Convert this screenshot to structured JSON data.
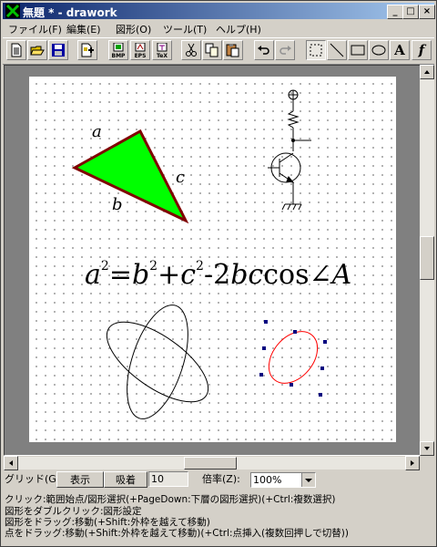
{
  "window": {
    "title": "無題 * - drawork"
  },
  "title_buttons": {
    "minimize": "_",
    "maximize": "□",
    "close": "×"
  },
  "menu": [
    "ファイル(F)",
    "編集(E)",
    "図形(O)",
    "ツール(T)",
    "ヘルプ(H)"
  ],
  "toolbar": {
    "bmp_label": "BMP",
    "eps_label": "EPS",
    "tex_label": "TeX",
    "text_tool": "A",
    "func_tool": "f"
  },
  "canvas": {
    "triangle_labels": {
      "a": "a",
      "b": "b",
      "c": "c"
    },
    "triangle_fill": "#00ff00",
    "triangle_stroke": "#800000",
    "ellipse_stroke": "#ff0000",
    "handle_color": "#000080"
  },
  "bottom": {
    "grid_label": "グリッド(G):",
    "show_button": "表示",
    "snap_button": "吸着",
    "grid_value": "10",
    "zoom_label": "倍率(Z):",
    "zoom_value": "100%"
  },
  "status_lines": [
    "クリック:範囲始点/図形選択(+PageDown:下層の図形選択)(+Ctrl:複数選択)",
    "図形をダブルクリック:図形設定",
    "図形をドラッグ:移動(+Shift:外枠を越えて移動)",
    "点をドラッグ:移動(+Shift:外枠を越えて移動)(+Ctrl:点挿入(複数回押しで切替))"
  ]
}
